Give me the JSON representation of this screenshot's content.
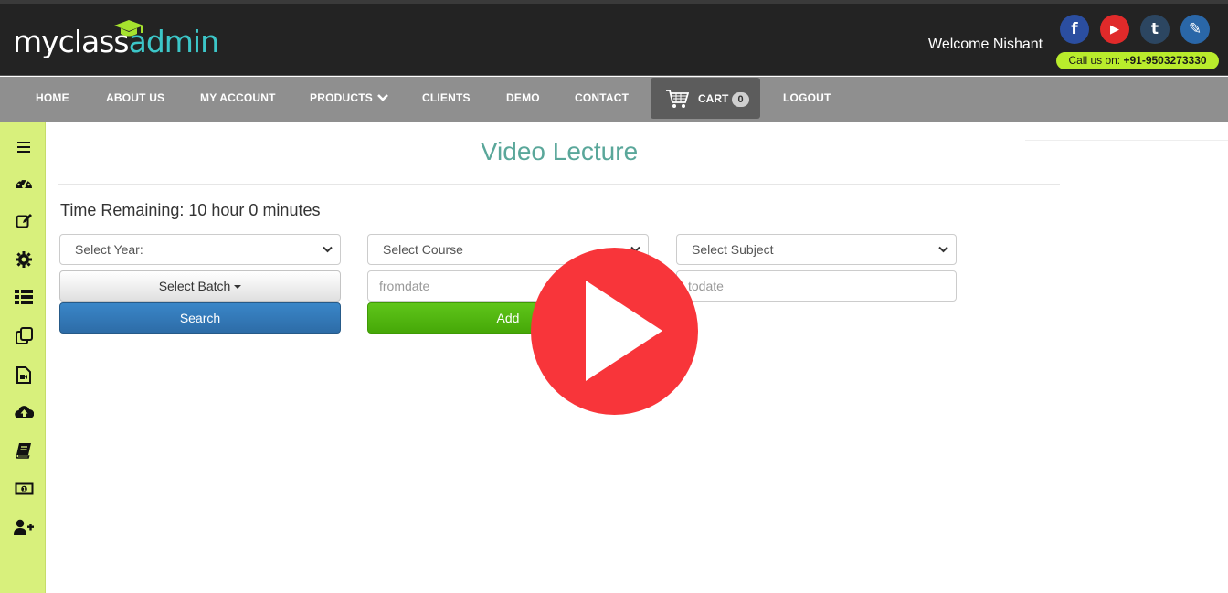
{
  "brand": {
    "logo_part1": "myclass",
    "logo_part2": "admin",
    "accent_color": "#3cc6c8",
    "logo_icon": "graduation-cap-icon"
  },
  "header": {
    "welcome": "Welcome Nishant",
    "call_prefix": "Call us on: ",
    "phone": "+91-9503273330",
    "social": [
      {
        "name": "facebook-icon",
        "glyph": "f",
        "color": "#2b4ea0"
      },
      {
        "name": "youtube-icon",
        "glyph": "▶",
        "color": "#e02a2a"
      },
      {
        "name": "tumblr-icon",
        "glyph": "t",
        "color": "#2c4661"
      },
      {
        "name": "edit-icon",
        "glyph": "✎",
        "color": "#2a67a8"
      }
    ]
  },
  "nav": {
    "items": [
      "HOME",
      "ABOUT US",
      "MY ACCOUNT",
      "PRODUCTS",
      "CLIENTS",
      "DEMO",
      "CONTACT"
    ],
    "cart_label": "CART",
    "cart_count": "0",
    "logout": "LOGOUT"
  },
  "sidebar": {
    "icons": [
      "menu-icon",
      "dashboard-icon",
      "edit-icon",
      "settings-icon",
      "list-icon",
      "copy-icon",
      "video-file-icon",
      "cloud-upload-icon",
      "book-icon",
      "money-icon",
      "add-user-icon"
    ]
  },
  "main": {
    "title": "Video Lecture",
    "time_remaining": "Time Remaining: 10 hour 0 minutes",
    "select_year": "Select Year:",
    "select_course": "Select Course",
    "select_subject": "Select Subject",
    "select_batch": "Select Batch",
    "fromdate_placeholder": "fromdate",
    "todate_placeholder": "todate",
    "search_label": "Search",
    "add_label": "Add"
  },
  "overlay": {
    "icon": "play-icon",
    "color": "#f8353a"
  }
}
